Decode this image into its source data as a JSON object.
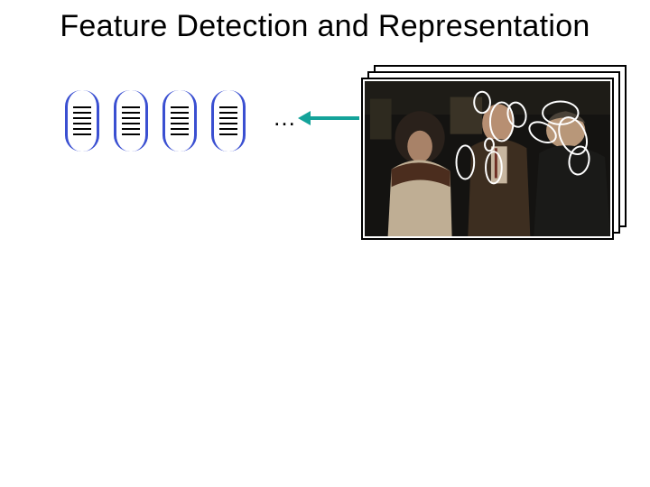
{
  "title": "Feature Detection and Representation",
  "ellipsis": "…",
  "vectors": {
    "count": 4,
    "lines_each": 6
  },
  "image": {
    "description": "Movie still (interior scene) with three adults talking; white ellipse overlays indicate detected features.",
    "overlays_label": "feature-ellipse"
  }
}
